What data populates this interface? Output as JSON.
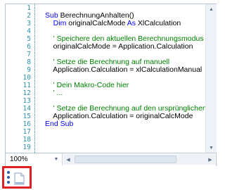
{
  "editor": {
    "line_numbers": [
      "1",
      "2",
      "3",
      "4",
      "5",
      "6",
      "7",
      "8",
      "9",
      "10",
      "11",
      "12",
      "13",
      "14",
      "15",
      "16",
      "17",
      "18",
      "19"
    ],
    "lines": [
      {
        "segments": []
      },
      {
        "segments": [
          {
            "t": "Sub ",
            "c": "kw"
          },
          {
            "t": "BerechnungAnhalten()",
            "c": "tx"
          }
        ]
      },
      {
        "segments": [
          {
            "t": "    Dim ",
            "c": "kw"
          },
          {
            "t": "originalCalcMode ",
            "c": "tx"
          },
          {
            "t": "As ",
            "c": "kw"
          },
          {
            "t": "XlCalculation",
            "c": "tx"
          }
        ]
      },
      {
        "segments": []
      },
      {
        "segments": [
          {
            "t": "    ' Speichere den aktuellen Berechnungsmodus",
            "c": "cm"
          }
        ]
      },
      {
        "segments": [
          {
            "t": "    originalCalcMode = Application.Calculation",
            "c": "tx"
          }
        ]
      },
      {
        "segments": []
      },
      {
        "segments": [
          {
            "t": "    ' Setze die Berechnung auf manuell",
            "c": "cm"
          }
        ]
      },
      {
        "segments": [
          {
            "t": "    Application.Calculation = xlCalculationManual",
            "c": "tx"
          }
        ]
      },
      {
        "segments": []
      },
      {
        "segments": [
          {
            "t": "    ' Dein Makro-Code hier",
            "c": "cm"
          }
        ]
      },
      {
        "segments": [
          {
            "t": "    ' ...",
            "c": "cm"
          }
        ]
      },
      {
        "segments": []
      },
      {
        "segments": [
          {
            "t": "    ' Setze die Berechnung auf den ursprünglichen Wert zurück",
            "c": "cm"
          }
        ]
      },
      {
        "segments": [
          {
            "t": "    Application.Calculation = originalCalcMode",
            "c": "tx"
          }
        ]
      },
      {
        "segments": [
          {
            "t": "End Sub",
            "c": "kw"
          }
        ]
      },
      {
        "segments": []
      },
      {
        "segments": []
      },
      {
        "segments": []
      }
    ]
  },
  "statusbar": {
    "zoom": "100%"
  },
  "icons": {
    "zoom_dropdown": "chevron-down-icon",
    "scroll_up": "arrow-up-icon",
    "scroll_down": "arrow-down-icon",
    "scroll_left": "arrow-left-icon",
    "scroll_right": "arrow-right-icon",
    "module": "code-module-icon"
  },
  "colors": {
    "keyword": "#0000ff",
    "comment": "#008000",
    "line_number": "#2b91af",
    "highlight_box": "#e02020"
  }
}
